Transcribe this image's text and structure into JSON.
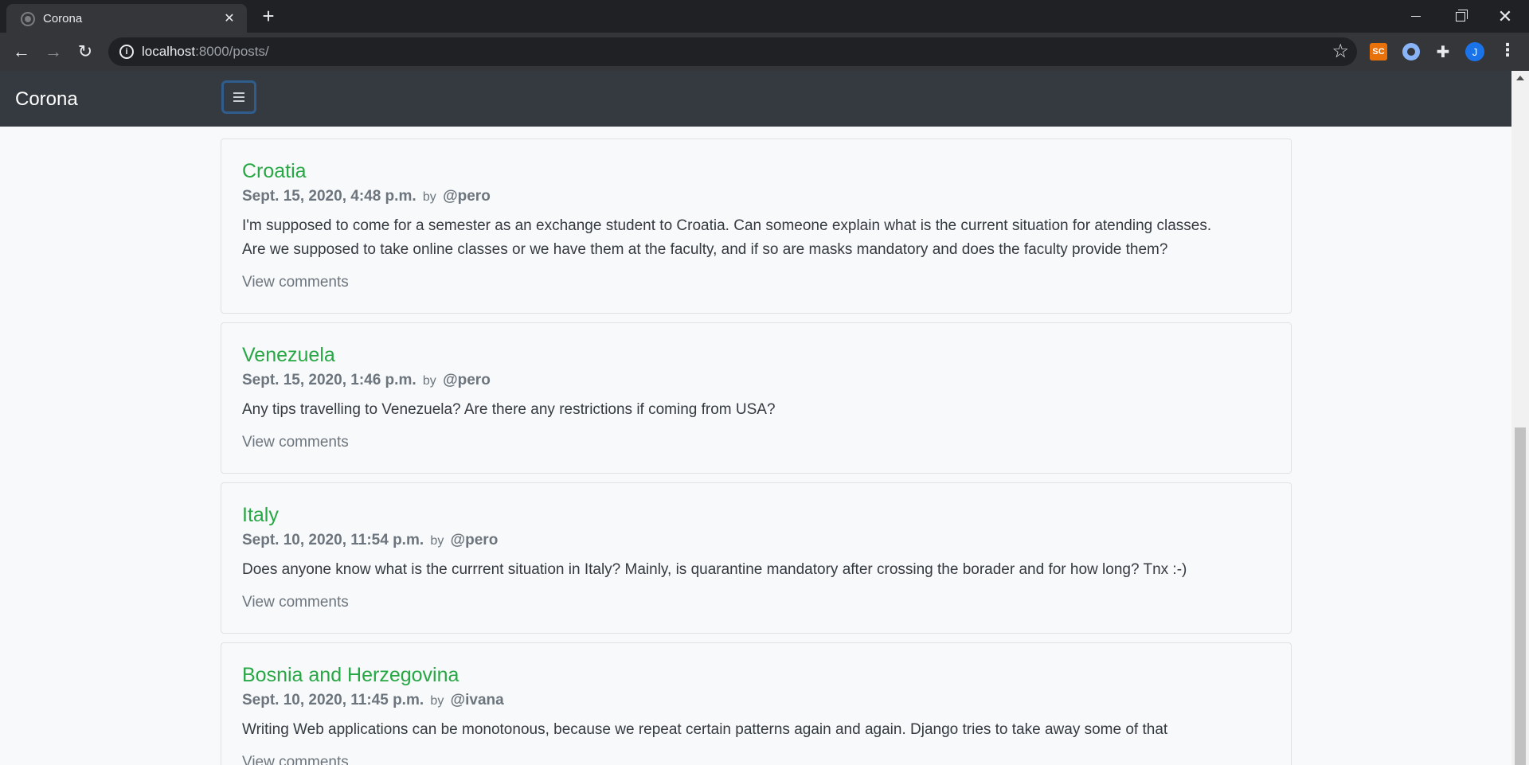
{
  "browser": {
    "tab_title": "Corona",
    "url_host": "localhost",
    "url_path": ":8000/posts/",
    "extension_sc": "SC",
    "avatar_initial": "J"
  },
  "site": {
    "brand": "Corona"
  },
  "posts": [
    {
      "title": "Croatia",
      "date": "Sept. 15, 2020, 4:48 p.m.",
      "by": "by",
      "author": "@pero",
      "body_lines": [
        "I'm supposed to come for a semester as an exchange student to Croatia. Can someone explain what is the current situation for atending classes.",
        "Are we supposed to take online classes or we have them at the faculty, and if so are masks mandatory and does the faculty provide them?"
      ],
      "link": "View comments"
    },
    {
      "title": "Venezuela",
      "date": "Sept. 15, 2020, 1:46 p.m.",
      "by": "by",
      "author": "@pero",
      "body_lines": [
        "Any tips travelling to Venezuela? Are there any restrictions if coming from USA?"
      ],
      "link": "View comments"
    },
    {
      "title": "Italy",
      "date": "Sept. 10, 2020, 11:54 p.m.",
      "by": "by",
      "author": "@pero",
      "body_lines": [
        "Does anyone know what is the currrent situation in Italy? Mainly, is quarantine mandatory after crossing the borader and for how long? Tnx :-)"
      ],
      "link": "View comments"
    },
    {
      "title": "Bosnia and Herzegovina",
      "date": "Sept. 10, 2020, 11:45 p.m.",
      "by": "by",
      "author": "@ivana",
      "body_lines": [
        "Writing Web applications can be monotonous, because we repeat certain patterns again and again. Django tries to take away some of that"
      ],
      "link": "View comments"
    }
  ],
  "icons": {
    "favicon": "globe-icon",
    "close": "close-icon",
    "new_tab": "plus-icon",
    "back": "arrow-left-icon",
    "forward": "arrow-right-icon",
    "reload": "reload-icon",
    "info": "info-icon",
    "bookmark": "star-icon",
    "extensions": "puzzle-icon",
    "menu": "more-vertical-icon",
    "toggler": "hamburger-icon"
  }
}
